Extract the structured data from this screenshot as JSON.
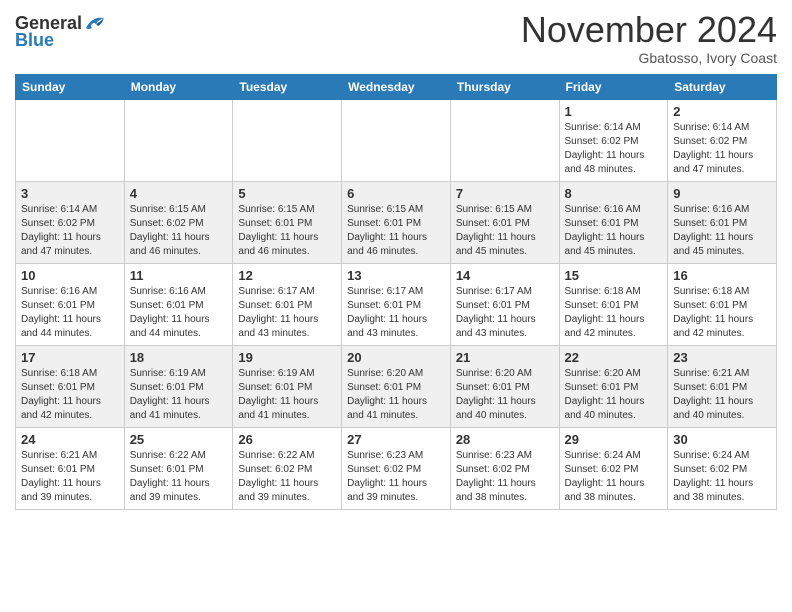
{
  "header": {
    "logo_general": "General",
    "logo_blue": "Blue",
    "month_title": "November 2024",
    "location": "Gbatosso, Ivory Coast"
  },
  "days_of_week": [
    "Sunday",
    "Monday",
    "Tuesday",
    "Wednesday",
    "Thursday",
    "Friday",
    "Saturday"
  ],
  "weeks": [
    [
      {
        "day": "",
        "info": ""
      },
      {
        "day": "",
        "info": ""
      },
      {
        "day": "",
        "info": ""
      },
      {
        "day": "",
        "info": ""
      },
      {
        "day": "",
        "info": ""
      },
      {
        "day": "1",
        "info": "Sunrise: 6:14 AM\nSunset: 6:02 PM\nDaylight: 11 hours\nand 48 minutes."
      },
      {
        "day": "2",
        "info": "Sunrise: 6:14 AM\nSunset: 6:02 PM\nDaylight: 11 hours\nand 47 minutes."
      }
    ],
    [
      {
        "day": "3",
        "info": "Sunrise: 6:14 AM\nSunset: 6:02 PM\nDaylight: 11 hours\nand 47 minutes."
      },
      {
        "day": "4",
        "info": "Sunrise: 6:15 AM\nSunset: 6:02 PM\nDaylight: 11 hours\nand 46 minutes."
      },
      {
        "day": "5",
        "info": "Sunrise: 6:15 AM\nSunset: 6:01 PM\nDaylight: 11 hours\nand 46 minutes."
      },
      {
        "day": "6",
        "info": "Sunrise: 6:15 AM\nSunset: 6:01 PM\nDaylight: 11 hours\nand 46 minutes."
      },
      {
        "day": "7",
        "info": "Sunrise: 6:15 AM\nSunset: 6:01 PM\nDaylight: 11 hours\nand 45 minutes."
      },
      {
        "day": "8",
        "info": "Sunrise: 6:16 AM\nSunset: 6:01 PM\nDaylight: 11 hours\nand 45 minutes."
      },
      {
        "day": "9",
        "info": "Sunrise: 6:16 AM\nSunset: 6:01 PM\nDaylight: 11 hours\nand 45 minutes."
      }
    ],
    [
      {
        "day": "10",
        "info": "Sunrise: 6:16 AM\nSunset: 6:01 PM\nDaylight: 11 hours\nand 44 minutes."
      },
      {
        "day": "11",
        "info": "Sunrise: 6:16 AM\nSunset: 6:01 PM\nDaylight: 11 hours\nand 44 minutes."
      },
      {
        "day": "12",
        "info": "Sunrise: 6:17 AM\nSunset: 6:01 PM\nDaylight: 11 hours\nand 43 minutes."
      },
      {
        "day": "13",
        "info": "Sunrise: 6:17 AM\nSunset: 6:01 PM\nDaylight: 11 hours\nand 43 minutes."
      },
      {
        "day": "14",
        "info": "Sunrise: 6:17 AM\nSunset: 6:01 PM\nDaylight: 11 hours\nand 43 minutes."
      },
      {
        "day": "15",
        "info": "Sunrise: 6:18 AM\nSunset: 6:01 PM\nDaylight: 11 hours\nand 42 minutes."
      },
      {
        "day": "16",
        "info": "Sunrise: 6:18 AM\nSunset: 6:01 PM\nDaylight: 11 hours\nand 42 minutes."
      }
    ],
    [
      {
        "day": "17",
        "info": "Sunrise: 6:18 AM\nSunset: 6:01 PM\nDaylight: 11 hours\nand 42 minutes."
      },
      {
        "day": "18",
        "info": "Sunrise: 6:19 AM\nSunset: 6:01 PM\nDaylight: 11 hours\nand 41 minutes."
      },
      {
        "day": "19",
        "info": "Sunrise: 6:19 AM\nSunset: 6:01 PM\nDaylight: 11 hours\nand 41 minutes."
      },
      {
        "day": "20",
        "info": "Sunrise: 6:20 AM\nSunset: 6:01 PM\nDaylight: 11 hours\nand 41 minutes."
      },
      {
        "day": "21",
        "info": "Sunrise: 6:20 AM\nSunset: 6:01 PM\nDaylight: 11 hours\nand 40 minutes."
      },
      {
        "day": "22",
        "info": "Sunrise: 6:20 AM\nSunset: 6:01 PM\nDaylight: 11 hours\nand 40 minutes."
      },
      {
        "day": "23",
        "info": "Sunrise: 6:21 AM\nSunset: 6:01 PM\nDaylight: 11 hours\nand 40 minutes."
      }
    ],
    [
      {
        "day": "24",
        "info": "Sunrise: 6:21 AM\nSunset: 6:01 PM\nDaylight: 11 hours\nand 39 minutes."
      },
      {
        "day": "25",
        "info": "Sunrise: 6:22 AM\nSunset: 6:01 PM\nDaylight: 11 hours\nand 39 minutes."
      },
      {
        "day": "26",
        "info": "Sunrise: 6:22 AM\nSunset: 6:02 PM\nDaylight: 11 hours\nand 39 minutes."
      },
      {
        "day": "27",
        "info": "Sunrise: 6:23 AM\nSunset: 6:02 PM\nDaylight: 11 hours\nand 39 minutes."
      },
      {
        "day": "28",
        "info": "Sunrise: 6:23 AM\nSunset: 6:02 PM\nDaylight: 11 hours\nand 38 minutes."
      },
      {
        "day": "29",
        "info": "Sunrise: 6:24 AM\nSunset: 6:02 PM\nDaylight: 11 hours\nand 38 minutes."
      },
      {
        "day": "30",
        "info": "Sunrise: 6:24 AM\nSunset: 6:02 PM\nDaylight: 11 hours\nand 38 minutes."
      }
    ]
  ]
}
